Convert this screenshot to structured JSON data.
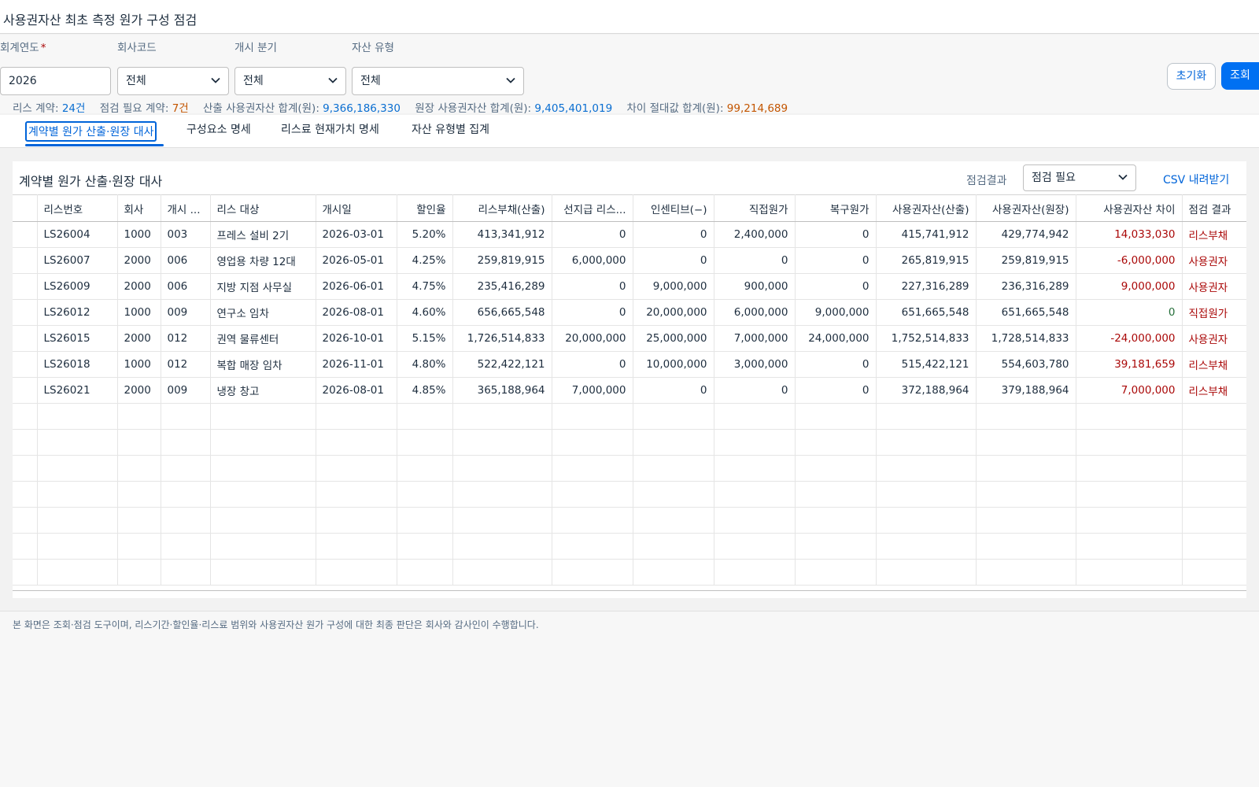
{
  "page": {
    "title": "사용권자산 최초 측정 원가 구성 점검"
  },
  "filters": {
    "fiscal_year": {
      "label": "회계연도",
      "required_mark": "*",
      "value": "2026"
    },
    "company_code": {
      "label": "회사코드",
      "value": "전체"
    },
    "start_quarter": {
      "label": "개시 분기",
      "value": "전체"
    },
    "asset_type": {
      "label": "자산 유형",
      "value": "전체"
    },
    "reset_label": "초기화",
    "search_label": "조회"
  },
  "summary": {
    "lease_contracts_label": "리스 계약:",
    "lease_contracts_value": "24건",
    "check_needed_label": "점검 필요 계약:",
    "check_needed_value": "7건",
    "calc_total_label": "산출 사용권자산 합계(원):",
    "calc_total_value": "9,366,186,330",
    "ledger_total_label": "원장 사용권자산 합계(원):",
    "ledger_total_value": "9,405,401,019",
    "diff_total_label": "차이 절대값 합계(원):",
    "diff_total_value": "99,214,689"
  },
  "tabs": [
    "계약별 원가 산출·원장 대사",
    "구성요소 명세",
    "리스료 현재가치 명세",
    "자산 유형별 집계"
  ],
  "panel": {
    "title": "계약별 원가 산출·원장 대사",
    "filter_label": "점검결과",
    "filter_value": "점검 필요",
    "csv_label": "CSV 내려받기"
  },
  "table": {
    "headers": [
      "",
      "리스번호",
      "회사",
      "개시 ...",
      "리스 대상",
      "개시일",
      "할인율",
      "리스부채(산출)",
      "선지급 리스...",
      "인센티브(−)",
      "직접원가",
      "복구원가",
      "사용권자산(산출)",
      "사용권자산(원장)",
      "사용권자산 차이",
      "점검 결과"
    ],
    "rows": [
      [
        "",
        "LS26004",
        "1000",
        "003",
        "프레스 설비 2기",
        "2026-03-01",
        "5.20%",
        "413,341,912",
        "0",
        "0",
        "2,400,000",
        "0",
        "415,741,912",
        "429,774,942",
        "14,033,030",
        "리스부채"
      ],
      [
        "",
        "LS26007",
        "2000",
        "006",
        "영업용 차량 12대",
        "2026-05-01",
        "4.25%",
        "259,819,915",
        "6,000,000",
        "0",
        "0",
        "0",
        "265,819,915",
        "259,819,915",
        "-6,000,000",
        "사용권자"
      ],
      [
        "",
        "LS26009",
        "2000",
        "006",
        "지방 지점 사무실",
        "2026-06-01",
        "4.75%",
        "235,416,289",
        "0",
        "9,000,000",
        "900,000",
        "0",
        "227,316,289",
        "236,316,289",
        "9,000,000",
        "사용권자"
      ],
      [
        "",
        "LS26012",
        "1000",
        "009",
        "연구소 임차",
        "2026-08-01",
        "4.60%",
        "656,665,548",
        "0",
        "20,000,000",
        "6,000,000",
        "9,000,000",
        "651,665,548",
        "651,665,548",
        "0",
        "직접원가"
      ],
      [
        "",
        "LS26015",
        "2000",
        "012",
        "권역 물류센터",
        "2026-10-01",
        "5.15%",
        "1,726,514,833",
        "20,000,000",
        "25,000,000",
        "7,000,000",
        "24,000,000",
        "1,752,514,833",
        "1,728,514,833",
        "-24,000,000",
        "사용권자"
      ],
      [
        "",
        "LS26018",
        "1000",
        "012",
        "복합 매장 임차",
        "2026-11-01",
        "4.80%",
        "522,422,121",
        "0",
        "10,000,000",
        "3,000,000",
        "0",
        "515,422,121",
        "554,603,780",
        "39,181,659",
        "리스부채"
      ],
      [
        "",
        "LS26021",
        "2000",
        "009",
        "냉장 창고",
        "2026-08-01",
        "4.85%",
        "365,188,964",
        "7,000,000",
        "0",
        "0",
        "0",
        "372,188,964",
        "379,188,964",
        "7,000,000",
        "리스부채"
      ]
    ],
    "empty_rows": 7
  },
  "footer": {
    "note": "본 화면은 조회·점검 도구이며, 리스기간·할인율·리스료 범위와 사용권자산 원가 구성에 대한 최종 판단은 회사와 감사인이 수행합니다."
  }
}
